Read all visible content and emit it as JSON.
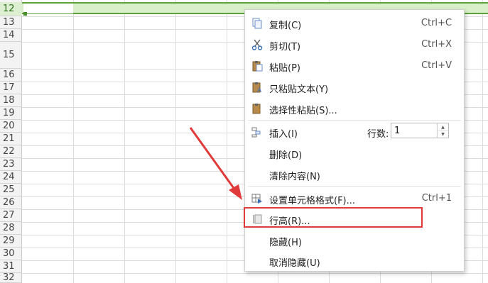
{
  "rows": [
    {
      "num": "12",
      "selected": true
    },
    {
      "num": "13"
    },
    {
      "num": "14"
    },
    {
      "num": "15"
    },
    {
      "num": "16"
    },
    {
      "num": "17"
    },
    {
      "num": "18"
    },
    {
      "num": "19"
    },
    {
      "num": "20"
    },
    {
      "num": "21"
    },
    {
      "num": "22"
    },
    {
      "num": "23"
    },
    {
      "num": "24"
    },
    {
      "num": "25"
    },
    {
      "num": "26"
    },
    {
      "num": "27"
    },
    {
      "num": "28"
    },
    {
      "num": "29"
    },
    {
      "num": "30"
    },
    {
      "num": "31"
    },
    {
      "num": "32"
    }
  ],
  "menu": {
    "copy": {
      "label": "复制(C)",
      "shortcut": "Ctrl+C",
      "icon": "copy-icon"
    },
    "cut": {
      "label": "剪切(T)",
      "shortcut": "Ctrl+X",
      "icon": "scissors-icon"
    },
    "paste": {
      "label": "粘贴(P)",
      "shortcut": "Ctrl+V",
      "icon": "paste-icon"
    },
    "paste_text": {
      "label": "只粘贴文本(Y)",
      "icon": "paste-text-icon"
    },
    "paste_special": {
      "label": "选择性粘贴(S)...",
      "icon": "paste-special-icon"
    },
    "insert": {
      "label": "插入(I)",
      "icon": "insert-rows-icon",
      "rows_label": "行数:",
      "rows_value": "1"
    },
    "delete": {
      "label": "删除(D)"
    },
    "clear": {
      "label": "清除内容(N)"
    },
    "format_cells": {
      "label": "设置单元格格式(F)...",
      "shortcut": "Ctrl+1",
      "icon": "format-cells-icon"
    },
    "row_height": {
      "label": "行高(R)...",
      "icon": "row-height-icon"
    },
    "hide": {
      "label": "隐藏(H)"
    },
    "unhide": {
      "label": "取消隐藏(U)"
    }
  },
  "colors": {
    "selection_border": "#5ca33a",
    "selection_fill": "#d9efc9",
    "highlight": "#e03a3a"
  }
}
